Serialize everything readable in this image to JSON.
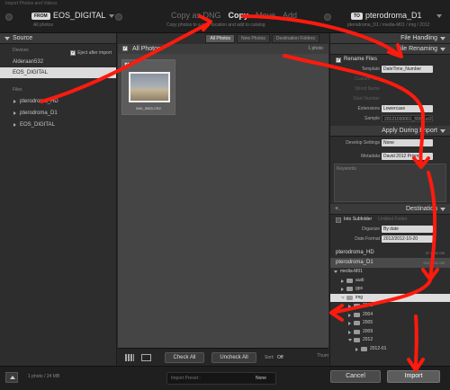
{
  "window_title": "Import Photos and Videos",
  "header": {
    "from_badge": "FROM",
    "source_name": "EOS_DIGITAL",
    "source_sub": "All photos",
    "modes": [
      {
        "label": "Copy as DNG",
        "active": false
      },
      {
        "label": "Copy",
        "active": true
      },
      {
        "label": "Move",
        "active": false
      },
      {
        "label": "Add",
        "active": false
      }
    ],
    "mode_description": "Copy photos to a new location and add to catalog",
    "to_badge": "TO",
    "dest_name": "pterodroma_D1",
    "dest_sub": "pterodroma_D1 / media-M01 / img / 2012"
  },
  "source_panel": {
    "title": "Source",
    "devices_label": "Devices",
    "eject_label": "Eject after import",
    "devices": [
      {
        "label": "Alderaan532",
        "selected": false
      },
      {
        "label": "EOS_DIGITAL",
        "selected": true
      }
    ],
    "files_label": "Files",
    "files": [
      "pterodroma_HD",
      "pterodroma_D1",
      "EOS_DIGITAL"
    ]
  },
  "center": {
    "tabs": [
      {
        "label": "All Photos",
        "active": true
      },
      {
        "label": "New Photos",
        "active": false
      },
      {
        "label": "Destination Folders",
        "active": false
      }
    ],
    "grid_title": "All Photos",
    "photo_count": "1 photo",
    "thumbnail_name": "IMG_5553.CR2",
    "toolbar": {
      "check_all": "Check All",
      "uncheck_all": "Uncheck All",
      "sort_label": "Sort:",
      "sort_value": "Off",
      "thumbnails_label": "Thum"
    }
  },
  "right_panel": {
    "file_handling_title": "File Handling",
    "file_renaming_title": "File Renaming",
    "rename_files_label": "Rename Files",
    "template_label": "Template",
    "template_value": "DateTime_Number",
    "custom_text_label": "Custom Text",
    "shoot_name_label": "Shoot Name",
    "start_number_label": "Start Number",
    "extensions_label": "Extensions",
    "extensions_value": "Lowercase",
    "sample_label": "Sample",
    "sample_value": "20121030001_5553.cr2",
    "apply_title": "Apply During Import",
    "develop_label": "Develop Settings",
    "develop_value": "None",
    "metadata_label": "Metadata",
    "metadata_value": "David 2012 Prism",
    "keywords_label": "Keywords",
    "destination_title": "Destination",
    "into_subfolder_label": "Into Subfolder",
    "subfolder_placeholder": "Untitled Folder",
    "organize_label": "Organize",
    "organize_value": "By date",
    "date_format_label": "Date Format",
    "date_format_value": "2012/2012-10-20",
    "volumes": [
      {
        "name": "pterodroma_HD",
        "meta": "37 / 232 GB",
        "selected": false
      },
      {
        "name": "pterodroma_D1",
        "meta": "904 / 931 GB",
        "selected": true
      }
    ],
    "tree": [
      {
        "label": "media-M01",
        "indent": 0,
        "open": true,
        "selected": false
      },
      {
        "label": "audi",
        "indent": 1,
        "open": false,
        "selected": false
      },
      {
        "label": "gps",
        "indent": 1,
        "open": false,
        "selected": false
      },
      {
        "label": "img",
        "indent": 1,
        "open": true,
        "selected": true
      },
      {
        "label": "2003",
        "indent": 2,
        "open": false,
        "selected": false
      },
      {
        "label": "2004",
        "indent": 2,
        "open": false,
        "selected": false
      },
      {
        "label": "2005",
        "indent": 2,
        "open": false,
        "selected": false
      },
      {
        "label": "2009",
        "indent": 2,
        "open": false,
        "selected": false
      },
      {
        "label": "2012",
        "indent": 2,
        "open": true,
        "selected": false
      },
      {
        "label": "2012-01",
        "indent": 3,
        "open": false,
        "selected": false
      }
    ]
  },
  "bottom_bar": {
    "summary": "1 photo / 24 MB",
    "preset_label": "Import Preset :",
    "preset_value": "None",
    "cancel_label": "Cancel",
    "import_label": "Import"
  },
  "annotation_color": "#ff1a0e"
}
